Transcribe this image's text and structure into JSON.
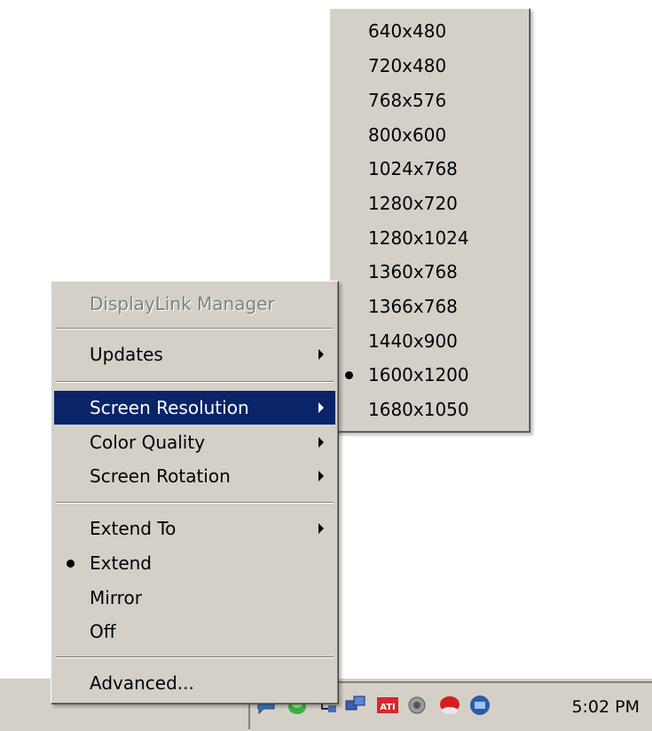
{
  "main_menu": {
    "title": "DisplayLink Manager",
    "items": [
      {
        "label": "Updates",
        "has_submenu": true,
        "checked": false
      },
      {
        "label": "Screen Resolution",
        "has_submenu": true,
        "checked": false,
        "selected": true
      },
      {
        "label": "Color Quality",
        "has_submenu": true,
        "checked": false
      },
      {
        "label": "Screen Rotation",
        "has_submenu": true,
        "checked": false
      },
      {
        "label": "Extend To",
        "has_submenu": true,
        "checked": false
      },
      {
        "label": "Extend",
        "has_submenu": false,
        "checked": true
      },
      {
        "label": "Mirror",
        "has_submenu": false,
        "checked": false
      },
      {
        "label": "Off",
        "has_submenu": false,
        "checked": false
      },
      {
        "label": "Advanced...",
        "has_submenu": false,
        "checked": false
      }
    ]
  },
  "resolution_menu": {
    "items": [
      {
        "label": "640x480",
        "checked": false
      },
      {
        "label": "720x480",
        "checked": false
      },
      {
        "label": "768x576",
        "checked": false
      },
      {
        "label": "800x600",
        "checked": false
      },
      {
        "label": "1024x768",
        "checked": false
      },
      {
        "label": "1280x720",
        "checked": false
      },
      {
        "label": "1280x1024",
        "checked": false
      },
      {
        "label": "1360x768",
        "checked": false
      },
      {
        "label": "1366x768",
        "checked": false
      },
      {
        "label": "1440x900",
        "checked": false
      },
      {
        "label": "1600x1200",
        "checked": true
      },
      {
        "label": "1680x1050",
        "checked": false
      }
    ]
  },
  "taskbar": {
    "clock": "5:02 PM",
    "tray_icons": [
      "chat-bubble-icon",
      "green-orb-icon",
      "network-icon",
      "monitors-icon",
      "ati-icon",
      "speaker-icon",
      "red-flag-icon",
      "displaylink-icon"
    ]
  },
  "colors": {
    "menu_bg": "#d4d0c8",
    "highlight": "#0a246a",
    "disabled_text": "#808080"
  }
}
